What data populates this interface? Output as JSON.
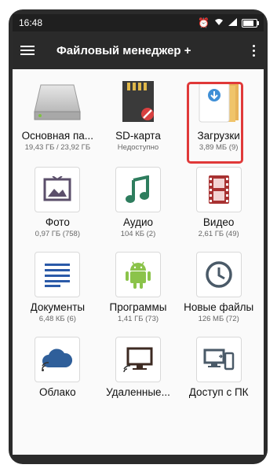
{
  "status": {
    "time": "16:48"
  },
  "appbar": {
    "title": "Файловый менеджер +"
  },
  "tiles": [
    {
      "label": "Основная па...",
      "sub": "19,43 ГБ / 23,92 ГБ"
    },
    {
      "label": "SD-карта",
      "sub": "Недоступно"
    },
    {
      "label": "Загрузки",
      "sub": "3,89 МБ (9)"
    },
    {
      "label": "Фото",
      "sub": "0,97 ГБ (758)"
    },
    {
      "label": "Аудио",
      "sub": "104 КБ (2)"
    },
    {
      "label": "Видео",
      "sub": "2,61 ГБ (49)"
    },
    {
      "label": "Документы",
      "sub": "6,48 КБ (6)"
    },
    {
      "label": "Программы",
      "sub": "1,41 ГБ (73)"
    },
    {
      "label": "Новые файлы",
      "sub": "126 МБ (72)"
    },
    {
      "label": "Облако",
      "sub": ""
    },
    {
      "label": "Удаленные...",
      "sub": ""
    },
    {
      "label": "Доступ с ПК",
      "sub": ""
    }
  ],
  "colors": {
    "accent": "#2b6cb0",
    "highlight": "#e03939",
    "android": "#8bc34a",
    "clock": "#4a5a68"
  }
}
